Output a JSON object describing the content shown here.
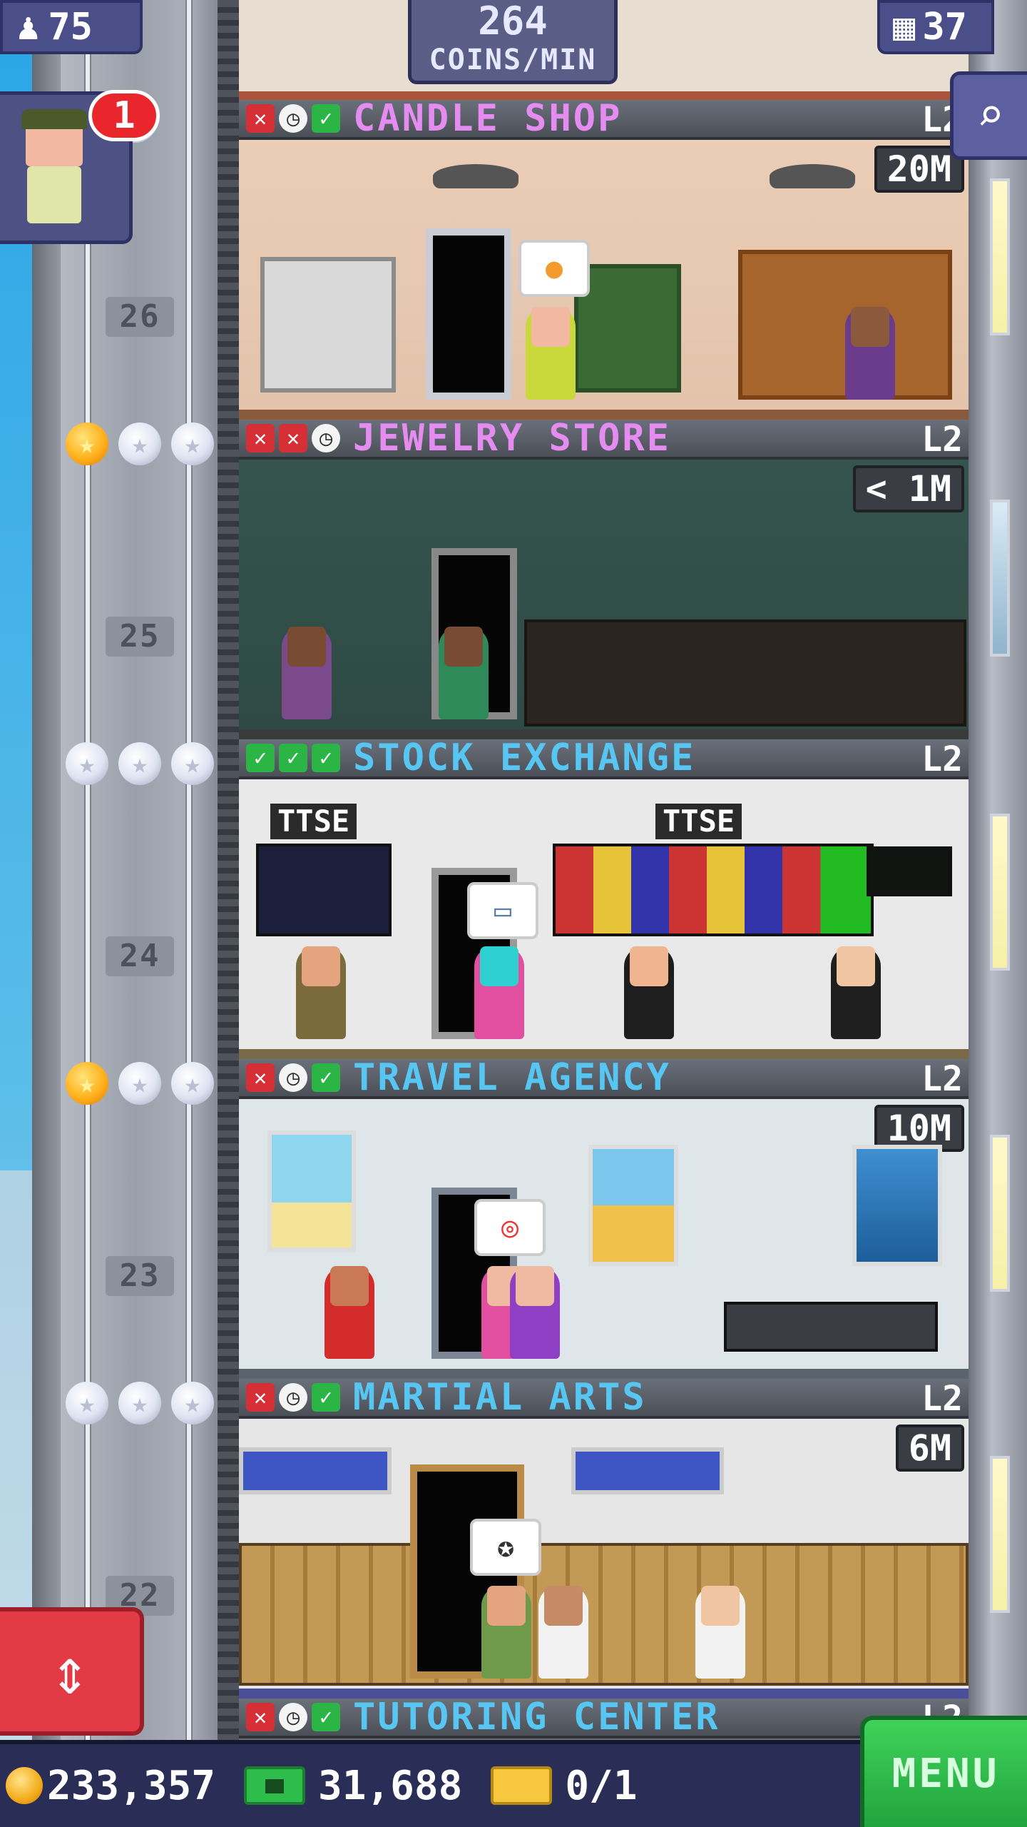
{
  "hud": {
    "population": "75",
    "coins_per_min": "264",
    "coins_per_min_label": "COINS/MIN",
    "floors_count": "37",
    "bellhop_badge": "1",
    "coins": "233,357",
    "tower_bux": "31,688",
    "vip_tickets": "0/1",
    "menu_label": "MENU"
  },
  "icons": {
    "population": "person-icon",
    "floors": "building-icon",
    "search": "magnifier-icon",
    "elevator": "up-down-arrows-icon",
    "coin": "coin-icon",
    "bux": "tower-bux-icon",
    "ticket": "vip-ticket-icon"
  },
  "colors": {
    "name_pink": "#e48cf0",
    "name_blue": "#57c6f2",
    "status_red": "#d62f35",
    "status_green": "#2bb545",
    "menu_green": "#2ebd4b"
  },
  "floors": [
    {
      "number": "26",
      "name": "CANDLE SHOP",
      "level": "L2",
      "stock": "20M",
      "status": [
        "x",
        "clock",
        "check"
      ],
      "stars_gold": 0
    },
    {
      "number": "25",
      "name": "JEWELRY STORE",
      "level": "L2",
      "stock": "< 1M",
      "status": [
        "x",
        "x",
        "clock"
      ],
      "stars_gold": 1
    },
    {
      "number": "24",
      "name": "STOCK EXCHANGE",
      "level": "L2",
      "stock": "",
      "status": [
        "check",
        "check",
        "check"
      ],
      "stars_gold": 0
    },
    {
      "number": "23",
      "name": "TRAVEL AGENCY",
      "level": "L2",
      "stock": "10M",
      "status": [
        "x",
        "clock",
        "check"
      ],
      "stars_gold": 1
    },
    {
      "number": "22",
      "name": "MARTIAL ARTS",
      "level": "L2",
      "stock": "6M",
      "status": [
        "x",
        "clock",
        "check"
      ],
      "stars_gold": 0
    },
    {
      "number": "",
      "name": "TUTORING CENTER",
      "level": "L2",
      "stock": "",
      "status": [
        "x",
        "clock",
        "check"
      ],
      "stars_gold": 0
    }
  ],
  "decor": {
    "ttse_1": "TTSE",
    "ttse_2": "TTSE"
  }
}
